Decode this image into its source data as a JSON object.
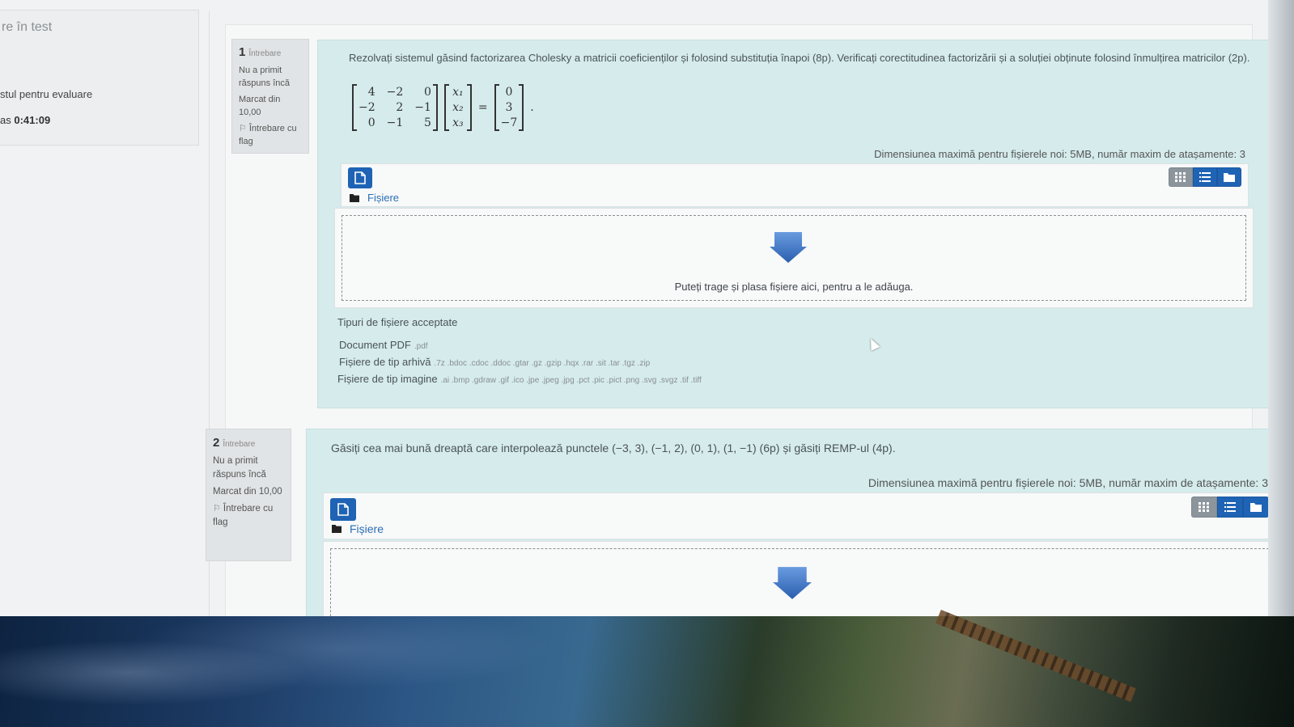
{
  "sidebar": {
    "title_fragment": "re în test",
    "review_fragment": "stul pentru evaluare",
    "time_prefix": "as",
    "time_value": "0:41:09"
  },
  "questions": [
    {
      "number": "1",
      "word": "Întrebare",
      "status": "Nu a primit răspuns încă",
      "marked": "Marcat din 10,00",
      "flag_label": "Întrebare cu flag",
      "text": "Rezolvați sistemul găsind factorizarea Cholesky a matricii coeficienților și folosind substituția înapoi (8p). Verificați corectitudinea factorizării și a soluției obținute folosind înmulțirea matricilor (2p).",
      "matrix_A": [
        "4",
        "−2",
        "0",
        "−2",
        "2",
        "−1",
        "0",
        "−1",
        "5"
      ],
      "vector_x": [
        "x₁",
        "x₂",
        "x₃"
      ],
      "equals": "=",
      "vector_b": [
        "0",
        "3",
        "−7"
      ],
      "period": ".",
      "max_size": "Dimensiunea maximă pentru fișierele noi: 5MB, număr maxim de atașamente: 3",
      "files_label": "Fișiere",
      "drop_text": "Puteți trage și plasa fișiere aici, pentru a le adăuga.",
      "accepted_title": "Tipuri de fișiere acceptate",
      "types": [
        {
          "label": "Document PDF",
          "ext": ".pdf"
        },
        {
          "label": "Fișiere de tip arhivă",
          "ext": ".7z .bdoc .cdoc .ddoc .gtar .gz .gzip .hqx .rar .sit .tar .tgz .zip"
        },
        {
          "label": "Fișiere de tip imagine",
          "ext": ".ai .bmp .gdraw .gif .ico .jpe .jpeg .jpg .pct .pic .pict .png .svg .svgz .tif .tiff"
        }
      ]
    },
    {
      "number": "2",
      "word": "Întrebare",
      "status": "Nu a primit răspuns încă",
      "marked": "Marcat din 10,00",
      "flag_label": "Întrebare cu flag",
      "text": "Găsiți cea mai bună dreaptă care interpolează punctele (−3, 3), (−1, 2), (0, 1), (1, −1) (6p) și găsiți REMP-ul (4p).",
      "max_size": "Dimensiunea maximă pentru fișierele noi: 5MB, număr maxim de atașamente: 3",
      "files_label": "Fișiere"
    }
  ],
  "icons": {
    "add_file": "file-add-icon",
    "view_grid": "grid-icon",
    "view_list": "list-icon",
    "view_tree": "folder-icon",
    "folder": "folder-icon",
    "drop_arrow": "arrow-down-icon",
    "flag": "flag-icon"
  },
  "colors": {
    "question_bg": "#d5ebec",
    "accent": "#1f63b4",
    "info_bg": "#e1e4e6"
  }
}
